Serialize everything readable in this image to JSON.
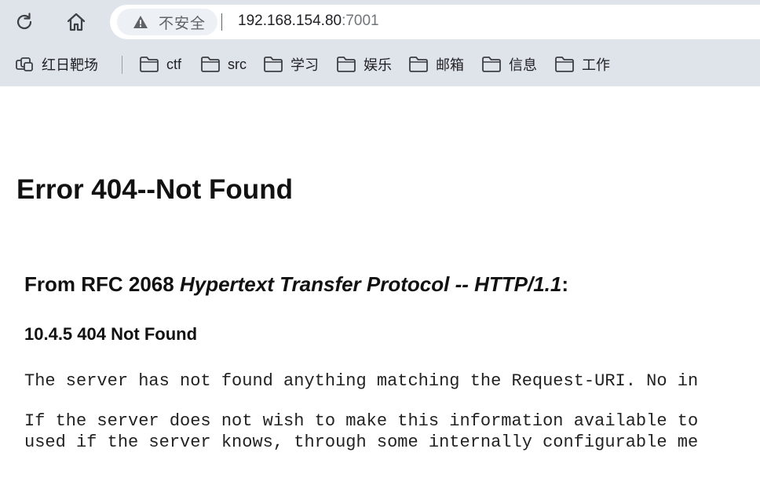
{
  "browser": {
    "security_label": "不安全",
    "url_host": "192.168.154.80",
    "url_port": ":7001",
    "bookmarks": [
      {
        "label": "红日靶场"
      },
      {
        "label": "ctf"
      },
      {
        "label": "src"
      },
      {
        "label": "学习"
      },
      {
        "label": "娱乐"
      },
      {
        "label": "邮箱"
      },
      {
        "label": "信息"
      },
      {
        "label": "工作"
      }
    ]
  },
  "page": {
    "title": "Error 404--Not Found",
    "rfc_prefix": "From RFC 2068 ",
    "rfc_italic": "Hypertext Transfer Protocol -- HTTP/1.1",
    "rfc_suffix": ":",
    "section": "10.4.5 404 Not Found",
    "para1": "The server has not found anything matching the Request-URI. No in",
    "para2_line1": "If the server does not wish to make this information available to",
    "para2_line2": "used if the server knows, through some internally configurable me"
  }
}
